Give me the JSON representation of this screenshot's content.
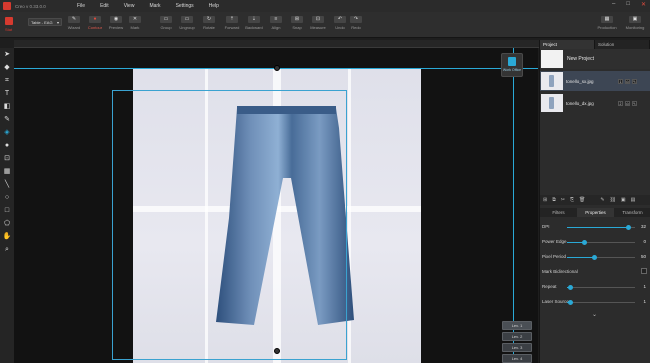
{
  "app": {
    "title": "Creo v 0.33.0.0"
  },
  "menu": [
    "File",
    "Edit",
    "View",
    "Mark",
    "Settings",
    "Help"
  ],
  "toolbar": {
    "left_label": "Stat",
    "table_select": "Table - EAG",
    "tools": [
      {
        "label": "Wizard",
        "icon": "✎"
      },
      {
        "label": "Contour",
        "icon": "●"
      },
      {
        "label": "Preview",
        "icon": "◉"
      },
      {
        "label": "Mark",
        "icon": "✕"
      },
      {
        "label": "Group",
        "icon": "▭"
      },
      {
        "label": "Ungroup",
        "icon": "▭"
      },
      {
        "label": "Rotate",
        "icon": "↻"
      },
      {
        "label": "Forward",
        "icon": "⇡"
      },
      {
        "label": "Backward",
        "icon": "⇣"
      },
      {
        "label": "Align",
        "icon": "≡"
      },
      {
        "label": "Snap",
        "icon": "⊞"
      },
      {
        "label": "Measure",
        "icon": "⊡"
      },
      {
        "label": "Undo",
        "icon": "↶"
      },
      {
        "label": "Redo",
        "icon": "↷"
      }
    ],
    "right_tools": [
      {
        "label": "Production",
        "icon": "▦"
      },
      {
        "label": "Monitoring",
        "icon": "▣"
      }
    ]
  },
  "canvas": {
    "float_button_label": "Work Office",
    "levels": [
      "Lev. 1",
      "Lev. 2",
      "Lev. 3",
      "Lev. 4"
    ]
  },
  "right_panel": {
    "tabs": [
      "Project",
      "Solution"
    ],
    "project_name": "New Project",
    "files": [
      {
        "name": "tonello_sx.jpg",
        "ctl": [
          "1",
          "⊙",
          "✎"
        ]
      },
      {
        "name": "tonello_dx.jpg",
        "ctl": [
          "2",
          "⊙",
          "✎"
        ]
      }
    ],
    "prop_tabs": [
      "Filters",
      "Properties",
      "Transform"
    ],
    "properties": [
      {
        "label": "DPI",
        "value": "32",
        "pct": 0.9
      },
      {
        "label": "Power Edge",
        "value": "0",
        "pct": 0.25
      },
      {
        "label": "Pixel Period",
        "value": "50",
        "pct": 0.4
      },
      {
        "label": "Mark Bidirectional",
        "value": ""
      },
      {
        "label": "Repeat",
        "value": "1",
        "pct": 0.05
      },
      {
        "label": "Laser Source",
        "value": "1",
        "pct": 0.05
      }
    ]
  }
}
